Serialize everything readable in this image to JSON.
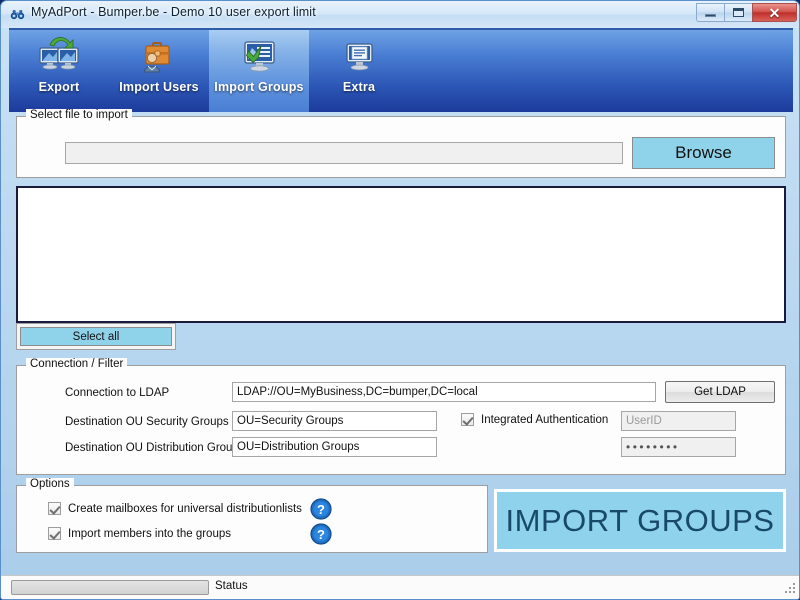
{
  "window": {
    "title": "MyAdPort - Bumper.be - Demo 10 user export limit",
    "app_icon": "binoculars-icon",
    "controls": {
      "minimize": "minimize-icon",
      "maximize": "maximize-icon",
      "close": "✕"
    }
  },
  "toolbar": {
    "tabs": [
      {
        "label": "Export",
        "icon": "export-monitors-icon",
        "active": false
      },
      {
        "label": "Import Users",
        "icon": "briefcase-user-icon",
        "active": false
      },
      {
        "label": "Import Groups",
        "icon": "monitor-green-arrow-icon",
        "active": true
      },
      {
        "label": "Extra",
        "icon": "monitor-document-icon",
        "active": false
      }
    ]
  },
  "file_group": {
    "title": "Select file to import",
    "path_value": "",
    "path_placeholder": "",
    "browse_label": "Browse"
  },
  "list_group": {
    "items": [],
    "select_all_label": "Select all"
  },
  "connection_group": {
    "title": "Connection / Filter",
    "ldap_label": "Connection to LDAP",
    "ldap_value": "LDAP://OU=MyBusiness,DC=bumper,DC=local",
    "get_ldap_label": "Get LDAP",
    "security_label": "Destination OU Security Groups",
    "security_value": "OU=Security Groups",
    "distribution_label": "Destination OU Distribution Groups",
    "distribution_value": "OU=Distribution Groups",
    "integrated_auth_label": "Integrated Authentication",
    "integrated_auth_checked": true,
    "userid_placeholder": "UserID",
    "userid_value": "",
    "password_value": "••••••••"
  },
  "options_group": {
    "title": "Options",
    "items": [
      {
        "label": "Create mailboxes for universal distributionlists",
        "checked": true,
        "help_icon": "help-question-icon"
      },
      {
        "label": "Import members into the groups",
        "checked": true,
        "help_icon": "help-question-icon"
      }
    ]
  },
  "action": {
    "import_label": "IMPORT GROUPS"
  },
  "statusbar": {
    "progress_percent": 0,
    "status_text": "Status",
    "grip_icon": "resize-grip-icon"
  },
  "colors": {
    "accent_blue": "#2b55b4",
    "tab_active": "#86b3e8",
    "button_cyan": "#8fd3ea",
    "big_button": "#8ed3eb",
    "big_button_text": "#18496b",
    "frame": "#bcd9f1"
  }
}
